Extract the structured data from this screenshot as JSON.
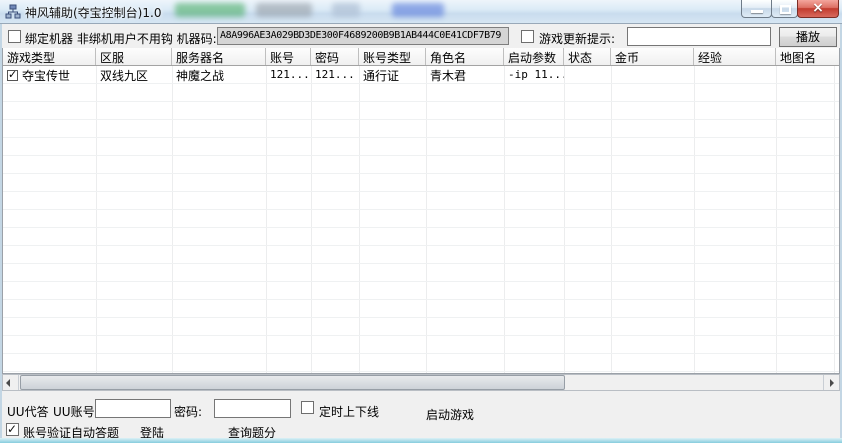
{
  "window": {
    "title": "神风辅助(夺宝控制台)1.0",
    "icons": {
      "close": "×"
    }
  },
  "topbar": {
    "bind_machine_label": "绑定机器 非绑机用户不用钩 机器码:",
    "machine_code": "A8A996AE3A029BD3DE300F4689200B9B1AB444C0E41CDF7B79",
    "update_prompt_label": "游戏更新提示:",
    "update_prompt_value": "",
    "play_button": "播放"
  },
  "table": {
    "columns": [
      "游戏类型",
      "区服",
      "服务器名",
      "账号",
      "密码",
      "账号类型",
      "角色名",
      "启动参数",
      "状态",
      "金币",
      "经验",
      "地图名"
    ],
    "rows": [
      {
        "checked": true,
        "game_type": "夺宝传世",
        "zone": "双线九区",
        "server": "神魔之战",
        "account": "121...",
        "password": "121...",
        "account_type": "通行证",
        "role": "青木君",
        "launch_params": "-ip 11...",
        "status": "",
        "gold": "",
        "exp": "",
        "map": ""
      }
    ]
  },
  "bottom": {
    "uu_answer_label": "UU代答",
    "uu_account_label": "UU账号:",
    "uu_account_value": "",
    "password_label": "密码:",
    "password_value": "",
    "schedule_checkbox_label": "定时上下线",
    "start_game_label": "启动游戏",
    "auto_answer_label": "账号验证自动答题",
    "login_label": "登陆",
    "query_score_label": "查询题分"
  },
  "colors": {
    "titlebar": "#d9e7f3",
    "client_bg": "#f0f0f0",
    "close_button": "#c23b2e",
    "bottom_edge": "#86ccdd"
  }
}
